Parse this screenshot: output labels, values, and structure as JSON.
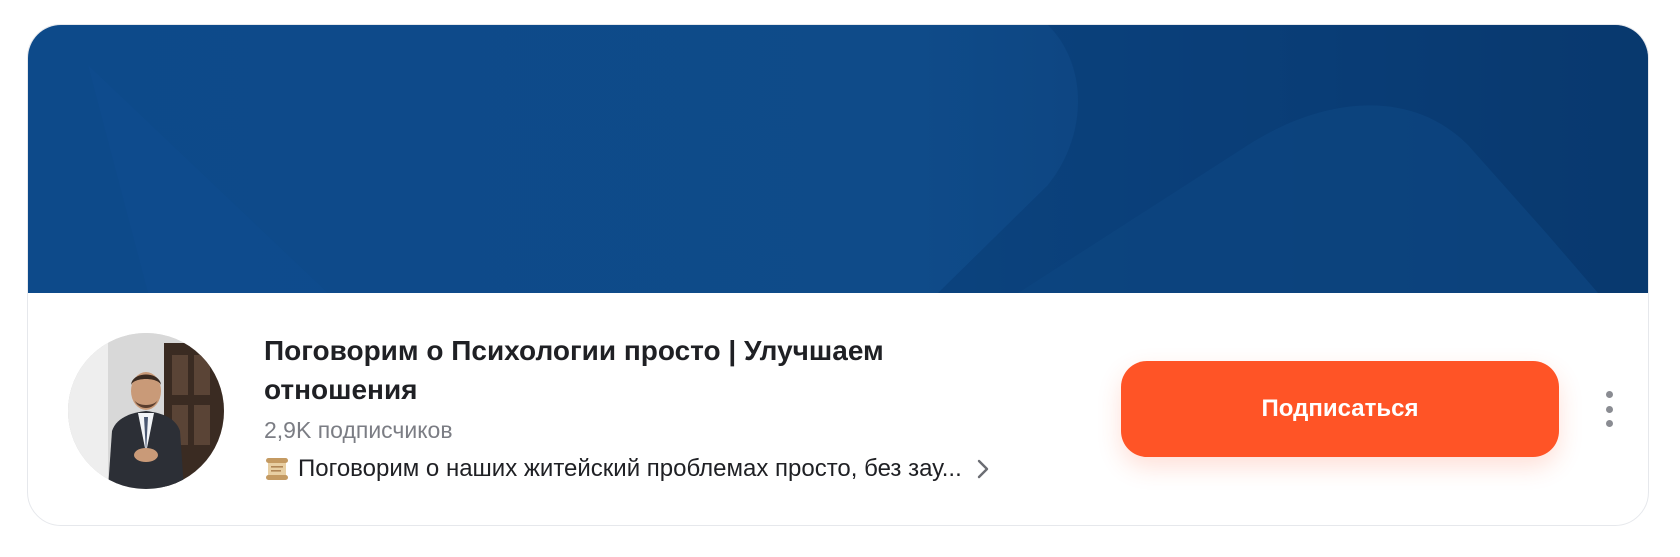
{
  "channel": {
    "title": "Поговорим о Психологии просто | Улучшаем отношения",
    "subscribers": "2,9K подписчиков",
    "description": "Поговорим о наших житейский проблемах просто, без зау...",
    "description_icon": "scroll-icon"
  },
  "actions": {
    "subscribe_label": "Подписаться",
    "more_icon": "more-vertical-icon"
  },
  "colors": {
    "cover": "#0f4b89",
    "accent": "#ff5426"
  }
}
